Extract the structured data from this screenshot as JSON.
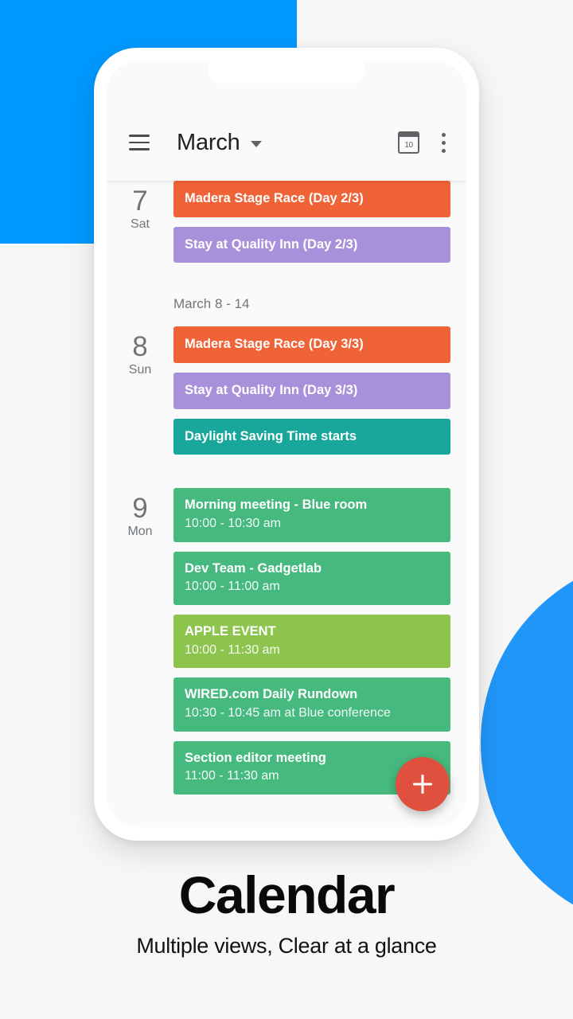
{
  "promo": {
    "title": "Calendar",
    "subtitle": "Multiple views, Clear at a glance",
    "accent_square_color": "#0099ff",
    "accent_circle_color": "#2196f9"
  },
  "appbar": {
    "menu_icon": "hamburger-menu-icon",
    "title": "March",
    "dropdown_icon": "chevron-down-icon",
    "today_icon": "calendar-today-icon",
    "today_date_number": "10",
    "overflow_icon": "more-vertical-icon"
  },
  "fab": {
    "icon": "plus-icon",
    "label": "Create event",
    "color": "#e0503f"
  },
  "agenda": {
    "week_label": "March 8 - 14",
    "days": [
      {
        "date": "7",
        "weekday": "Sat",
        "events": [
          {
            "title": "Madera Stage Race (Day 2/3)",
            "time": "",
            "color": "#ef6337"
          },
          {
            "title": "Stay at Quality Inn (Day 2/3)",
            "time": "",
            "color": "#a891da"
          }
        ]
      },
      {
        "date": "8",
        "weekday": "Sun",
        "events": [
          {
            "title": "Madera Stage Race (Day 3/3)",
            "time": "",
            "color": "#ef6337"
          },
          {
            "title": "Stay at Quality Inn (Day 3/3)",
            "time": "",
            "color": "#a891da"
          },
          {
            "title": "Daylight Saving Time starts",
            "time": "",
            "color": "#1aa79b"
          }
        ]
      },
      {
        "date": "9",
        "weekday": "Mon",
        "events": [
          {
            "title": "Morning meeting - Blue room",
            "time": "10:00 - 10:30 am",
            "color": "#46b97e"
          },
          {
            "title": "Dev Team - Gadgetlab",
            "time": "10:00 - 11:00 am",
            "color": "#46b97e"
          },
          {
            "title": "APPLE EVENT",
            "time": "10:00 - 11:30 am",
            "color": "#8cc44e"
          },
          {
            "title": "WIRED.com Daily Rundown",
            "time": "10:30 - 10:45 am at Blue conference",
            "color": "#46b97e"
          },
          {
            "title": "Section editor meeting",
            "time": "11:00 - 11:30 am",
            "color": "#46b97e"
          }
        ]
      }
    ]
  }
}
